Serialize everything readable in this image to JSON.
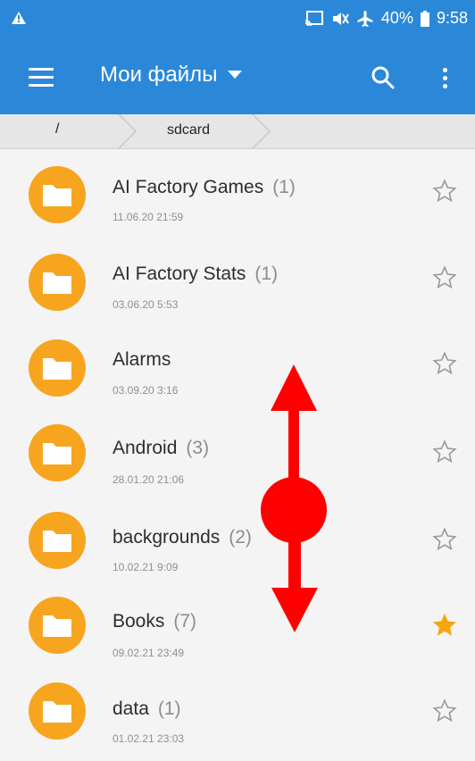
{
  "status_bar": {
    "battery_percent": "40%",
    "time": "9:58",
    "icons": [
      "warning-icon",
      "cast-icon",
      "mute-icon",
      "airplane-icon",
      "battery-icon"
    ]
  },
  "app_bar": {
    "title": "Мои файлы",
    "icons": [
      "menu-icon",
      "dropdown-arrow-icon",
      "search-icon",
      "more-vert-icon"
    ]
  },
  "path": {
    "root": "/",
    "current": "sdcard"
  },
  "files": [
    {
      "name": "AI Factory Games",
      "count": "(1)",
      "date": "11.06.20 21:59",
      "favorite": false
    },
    {
      "name": "AI Factory Stats",
      "count": "(1)",
      "date": "03.06.20 5:53",
      "favorite": false
    },
    {
      "name": "Alarms",
      "count": "",
      "date": "03.09.20 3:16",
      "favorite": false
    },
    {
      "name": "Android",
      "count": "(3)",
      "date": "28.01.20 21:06",
      "favorite": false
    },
    {
      "name": "backgrounds",
      "count": "(2)",
      "date": "10.02.21 9:09",
      "favorite": false
    },
    {
      "name": "Books",
      "count": "(7)",
      "date": "09.02.21 23:49",
      "favorite": true
    },
    {
      "name": "data",
      "count": "(1)",
      "date": "01.02.21 23:03",
      "favorite": false
    }
  ],
  "colors": {
    "app_bar": "#2b88d9",
    "folder": "#f7a51f",
    "favorite_star": "#f5a60f",
    "gesture_overlay": "#ff0000"
  }
}
